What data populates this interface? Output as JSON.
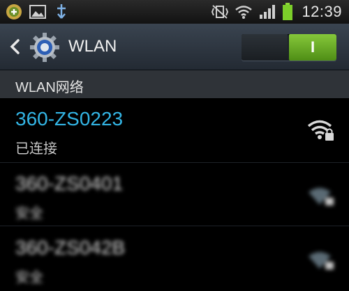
{
  "status_bar": {
    "time": "12:39",
    "left_icons": [
      "app-notification-icon",
      "gallery-icon",
      "usb-icon"
    ],
    "right_icons": [
      "vibrate-icon",
      "wifi-icon",
      "signal-icon",
      "battery-icon"
    ]
  },
  "header": {
    "title": "WLAN",
    "toggle_label": "I"
  },
  "section": {
    "title": "WLAN网络"
  },
  "networks": [
    {
      "name": "360-ZS0223",
      "status": "已连接",
      "name_color": "#33b5e5"
    },
    {
      "name": "360-ZS0401",
      "status": "安全",
      "name_color": "#d8d8d8"
    },
    {
      "name": "360-ZS042B",
      "status": "安全",
      "name_color": "#d8d8d8"
    }
  ]
}
